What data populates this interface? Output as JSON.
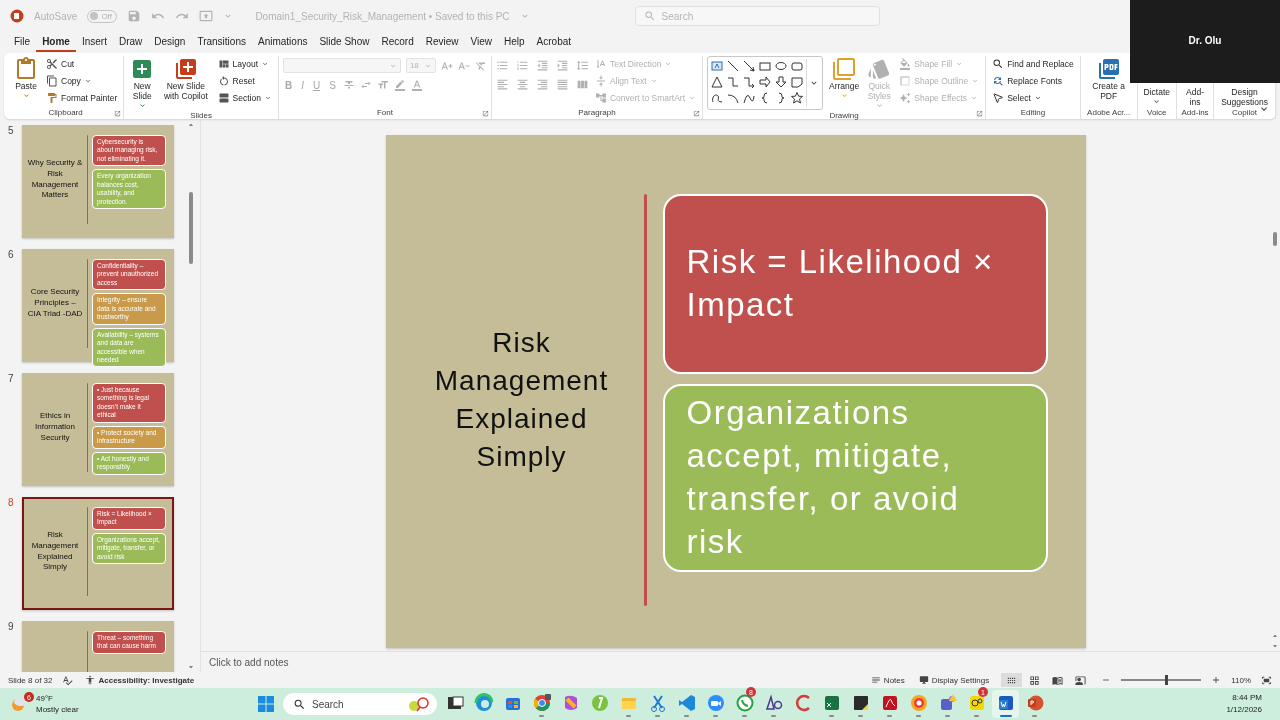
{
  "titlebar": {
    "autosave_label": "AutoSave",
    "autosave_toggle": {
      "label": "Off",
      "on": false
    },
    "document_title": "Domain1_Security_Risk_Management • Saved to this PC",
    "search": {
      "placeholder": "Search"
    }
  },
  "video_tile": {
    "name": "Dr. Olu"
  },
  "menu_tabs": [
    {
      "label": "File",
      "selected": false
    },
    {
      "label": "Home",
      "selected": true
    },
    {
      "label": "Insert",
      "selected": false
    },
    {
      "label": "Draw",
      "selected": false
    },
    {
      "label": "Design",
      "selected": false
    },
    {
      "label": "Transitions",
      "selected": false
    },
    {
      "label": "Animations",
      "selected": false
    },
    {
      "label": "Slide Show",
      "selected": false
    },
    {
      "label": "Record",
      "selected": false
    },
    {
      "label": "Review",
      "selected": false
    },
    {
      "label": "View",
      "selected": false
    },
    {
      "label": "Help",
      "selected": false
    },
    {
      "label": "Acrobat",
      "selected": false
    }
  ],
  "ribbon": {
    "groups": [
      {
        "label": "Clipboard",
        "kind": "clipboard",
        "buttons": [
          {
            "label": "Paste",
            "kind": "large",
            "menu": true,
            "disabled": false
          },
          {
            "label": "Cut",
            "kind": "small",
            "menu": false,
            "disabled": false
          },
          {
            "label": "Copy",
            "kind": "small",
            "menu": true,
            "disabled": false
          },
          {
            "label": "Format Painter",
            "kind": "small",
            "menu": false,
            "disabled": false
          }
        ]
      },
      {
        "label": "Slides",
        "kind": "slides",
        "buttons": [
          {
            "label": "New Slide",
            "kind": "large",
            "menu": true,
            "disabled": false
          },
          {
            "label": "New Slide with Copilot",
            "kind": "large",
            "menu": false,
            "disabled": false
          },
          {
            "label": "Layout",
            "kind": "small",
            "menu": true,
            "disabled": false
          },
          {
            "label": "Reset",
            "kind": "small",
            "menu": false,
            "disabled": false
          },
          {
            "label": "Section",
            "kind": "small",
            "menu": true,
            "disabled": false
          }
        ]
      },
      {
        "label": "Font",
        "kind": "font",
        "font_size": "18",
        "format_buttons": [
          "B",
          "I",
          "U",
          "S"
        ]
      },
      {
        "label": "Paragraph",
        "kind": "paragraph",
        "buttons": [
          {
            "label": "Text Direction",
            "kind": "small",
            "menu": true,
            "disabled": true
          },
          {
            "label": "Align Text",
            "kind": "small",
            "menu": true,
            "disabled": true
          },
          {
            "label": "Convert to SmartArt",
            "kind": "small",
            "menu": true,
            "disabled": true
          }
        ]
      },
      {
        "label": "Drawing",
        "kind": "drawing",
        "buttons": [
          {
            "label": "Arrange",
            "kind": "large",
            "menu": true,
            "disabled": false
          },
          {
            "label": "Quick Styles",
            "kind": "large",
            "menu": true,
            "disabled": true
          },
          {
            "label": "Shape Fill",
            "kind": "small",
            "menu": true,
            "disabled": true
          },
          {
            "label": "Shape Outline",
            "kind": "small",
            "menu": true,
            "disabled": true
          },
          {
            "label": "Shape Effects",
            "kind": "small",
            "menu": true,
            "disabled": true
          }
        ]
      },
      {
        "label": "Editing",
        "kind": "editing",
        "buttons": [
          {
            "label": "Find and Replace",
            "kind": "small",
            "menu": false,
            "disabled": false
          },
          {
            "label": "Replace Fonts",
            "kind": "small",
            "menu": false,
            "disabled": false
          },
          {
            "label": "Select",
            "kind": "small",
            "menu": true,
            "disabled": false
          }
        ]
      },
      {
        "label": "Adobe Acr...",
        "kind": "adobe",
        "buttons": [
          {
            "label": "Create a PDF",
            "kind": "large",
            "menu": false,
            "disabled": false
          }
        ]
      },
      {
        "label": "Voice",
        "kind": "covered",
        "buttons": [
          {
            "label": "Dictate",
            "kind": "covered",
            "menu": true,
            "disabled": false
          }
        ]
      },
      {
        "label": "Add-ins",
        "kind": "covered",
        "buttons": [
          {
            "label": "Add-ins",
            "kind": "covered",
            "menu": false,
            "disabled": false
          }
        ]
      },
      {
        "label": "Copilot",
        "kind": "covered",
        "buttons": [
          {
            "label": "Design Suggestions",
            "kind": "covered",
            "menu": false,
            "disabled": false
          }
        ]
      }
    ]
  },
  "slides": [
    {
      "number": "5",
      "title": "Why Security & Risk Management Matters",
      "selected": false,
      "boxes": [
        {
          "text": "Cybersecurity is about managing risk, not eliminating it.",
          "color": "#c0504d"
        },
        {
          "text": "Every organization balances cost, usability, and protection.",
          "color": "#9bbb59"
        }
      ]
    },
    {
      "number": "6",
      "title": "Core Security Principles – CIA Triad -DAD",
      "selected": false,
      "boxes": [
        {
          "text": "Confidentiality – prevent unauthorized access",
          "color": "#c0504d"
        },
        {
          "text": "Integrity – ensure data is accurate and trustworthy",
          "color": "#c89a4a"
        },
        {
          "text": "Availability – systems and data are accessible when needed",
          "color": "#9bbb59"
        }
      ]
    },
    {
      "number": "7",
      "title": "Ethics in Information Security",
      "selected": false,
      "boxes": [
        {
          "text": "• Just because something is legal doesn’t make it ethical",
          "color": "#c0504d"
        },
        {
          "text": "• Protect society and infrastructure",
          "color": "#c89a4a"
        },
        {
          "text": "• Act honestly and responsibly",
          "color": "#9bbb59"
        }
      ]
    },
    {
      "number": "8",
      "title": "Risk Management Explained Simply",
      "selected": true,
      "boxes": [
        {
          "text": "Risk = Likelihood × Impact",
          "color": "#c0504d"
        },
        {
          "text": "Organizations accept, mitigate, transfer, or avoid risk",
          "color": "#9bbb59"
        }
      ]
    },
    {
      "number": "9",
      "selected": false,
      "boxes": [
        {
          "text": "Threat – something that can cause harm",
          "color": "#c0504d"
        }
      ]
    }
  ],
  "slide": {
    "title": "Risk Management Explained Simply",
    "boxes": [
      {
        "text": "Risk = Likelihood × Impact",
        "color": "#c0504d"
      },
      {
        "text": "Organizations accept, mitigate, transfer, or avoid risk",
        "color": "#9bbb59"
      }
    ]
  },
  "notes": {
    "placeholder": "Click to add notes"
  },
  "status_bar": {
    "slide_counter": "Slide 8 of 32",
    "accessibility": "Accessibility: Investigate",
    "notes_button": "Notes",
    "display_settings": "Display Settings",
    "views": [
      {
        "selected": true
      },
      {
        "selected": false
      },
      {
        "selected": false
      },
      {
        "selected": false
      }
    ],
    "zoom": {
      "level": 0.55,
      "reading": "110%"
    }
  },
  "taskbar": {
    "weather": {
      "temperature": "49°F",
      "condition": "Mostly clear",
      "badge": "6"
    },
    "search": {
      "placeholder": "Search"
    },
    "apps": [
      {
        "running": false,
        "selected": false
      },
      {
        "running": false,
        "selected": false
      },
      {
        "running": false,
        "selected": false
      },
      {
        "running": true,
        "selected": false
      },
      {
        "running": false,
        "selected": false
      },
      {
        "running": false,
        "selected": false
      },
      {
        "running": true,
        "selected": false
      },
      {
        "running": true,
        "selected": false
      },
      {
        "running": true,
        "selected": false
      },
      {
        "running": true,
        "selected": false
      },
      {
        "running": true,
        "selected": false,
        "badge": "8"
      },
      {
        "running": true,
        "selected": false
      },
      {
        "running": false,
        "selected": false
      },
      {
        "running": true,
        "selected": false
      },
      {
        "running": true,
        "selected": false
      },
      {
        "running": true,
        "selected": false
      },
      {
        "running": true,
        "selected": false
      },
      {
        "running": true,
        "selected": false
      },
      {
        "running": true,
        "selected": false,
        "badge": "1"
      },
      {
        "running": true,
        "selected": true
      },
      {
        "running": true,
        "selected": false
      }
    ],
    "clock": {
      "time": "8:44 PM",
      "date": "1/12/2026"
    }
  }
}
